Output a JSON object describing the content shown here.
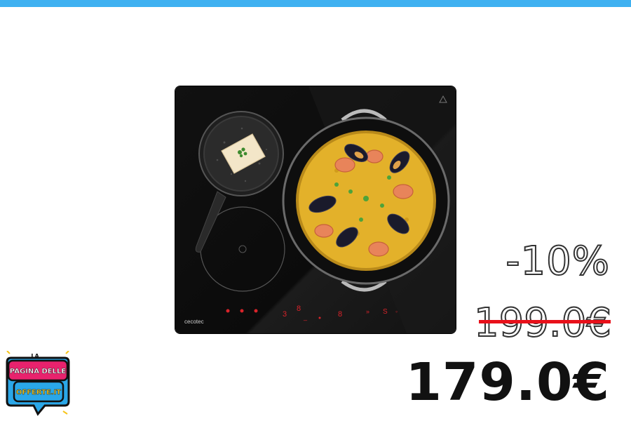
{
  "product": {
    "brand_label": "cecotec",
    "image_icon": "induction-hob-photo"
  },
  "pricing": {
    "discount": "-10%",
    "old_price": "199.0€",
    "new_price": "179.0€"
  },
  "logo": {
    "line1": "LA",
    "line2": "PAGINA DELLE",
    "line3": "OFFERTE.IT"
  },
  "colors": {
    "accent_bar": "#3fb1f1",
    "strike": "#e8101a",
    "logo_pink": "#e8226d",
    "logo_blue": "#2aa7e8",
    "logo_yellow": "#f7c51b"
  }
}
